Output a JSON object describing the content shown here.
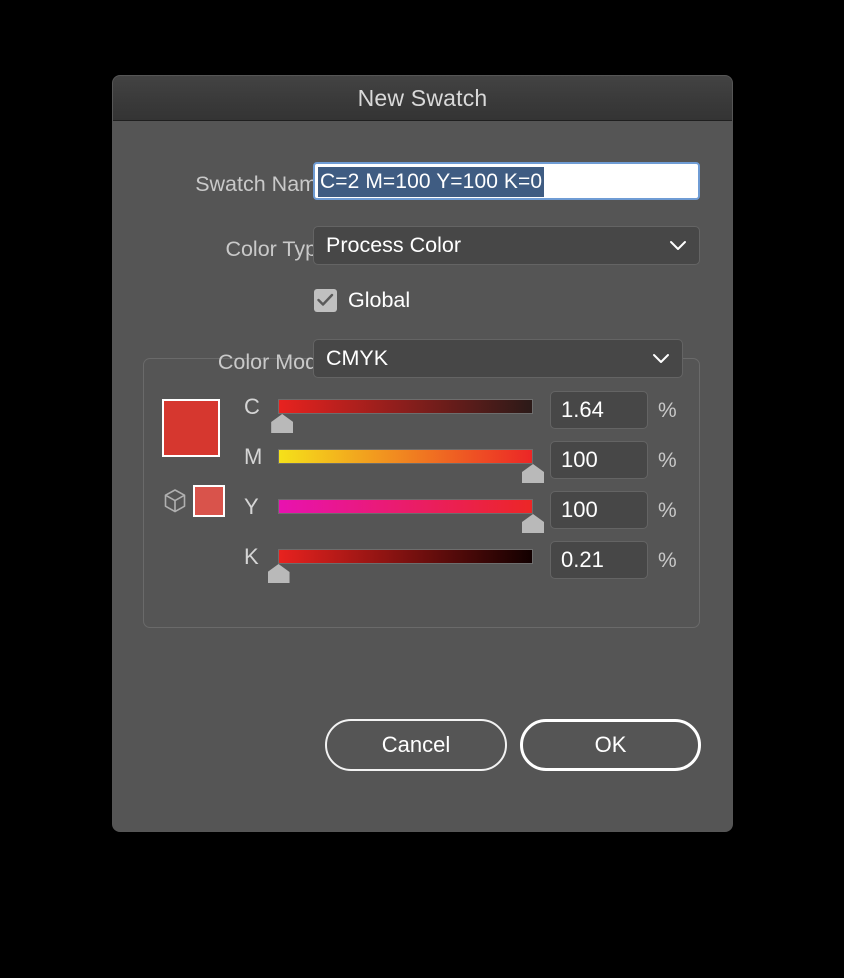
{
  "dialog": {
    "title": "New Swatch"
  },
  "fields": {
    "swatch_name_label": "Swatch Name:",
    "swatch_name_value": "C=2 M=100 Y=100 K=0",
    "color_type_label": "Color Type:",
    "color_type_value": "Process Color",
    "global_label": "Global",
    "global_checked": true,
    "color_mode_label": "Color Mode:",
    "color_mode_value": "CMYK"
  },
  "preview": {
    "swatch_color": "#d6372f",
    "alt_swatch_color": "#d9534b",
    "gamut_icon": "color-cube-icon"
  },
  "sliders": [
    {
      "channel": "C",
      "value": "1.64",
      "unit": "%",
      "percent": 1.64,
      "gradient_from": "#e8221f",
      "gradient_to": "#2b1a18"
    },
    {
      "channel": "M",
      "value": "100",
      "unit": "%",
      "percent": 100,
      "gradient_from": "#f5e11a",
      "gradient_to": "#ec2626"
    },
    {
      "channel": "Y",
      "value": "100",
      "unit": "%",
      "percent": 100,
      "gradient_from": "#e812b0",
      "gradient_to": "#ec2626"
    },
    {
      "channel": "K",
      "value": "0.21",
      "unit": "%",
      "percent": 0.21,
      "gradient_from": "#e8221f",
      "gradient_to": "#120000"
    }
  ],
  "buttons": {
    "cancel_label": "Cancel",
    "ok_label": "OK"
  },
  "icons": {
    "chevron_down": "chevron-down-icon",
    "checkmark": "check-icon"
  }
}
